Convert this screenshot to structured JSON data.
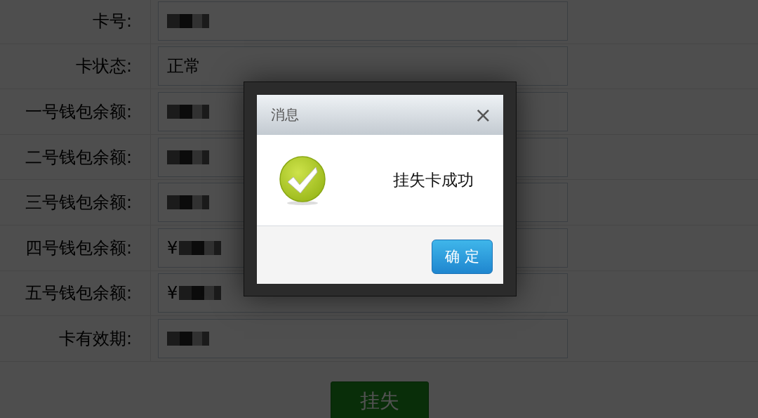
{
  "form": {
    "rows": [
      {
        "label": "卡号:",
        "kind": "masked"
      },
      {
        "label": "卡状态:",
        "value": "正常",
        "kind": "text"
      },
      {
        "label": "一号钱包余额:",
        "kind": "masked"
      },
      {
        "label": "二号钱包余额:",
        "kind": "masked"
      },
      {
        "label": "三号钱包余额:",
        "kind": "masked"
      },
      {
        "label": "四号钱包余额:",
        "value": "¥",
        "kind": "masked"
      },
      {
        "label": "五号钱包余额:",
        "value": "¥",
        "kind": "masked"
      },
      {
        "label": "卡有效期:",
        "kind": "masked"
      }
    ],
    "submit_button": "挂失"
  },
  "dialog": {
    "title": "消息",
    "close": "×",
    "message": "挂失卡成功",
    "ok_button": "确 定"
  }
}
